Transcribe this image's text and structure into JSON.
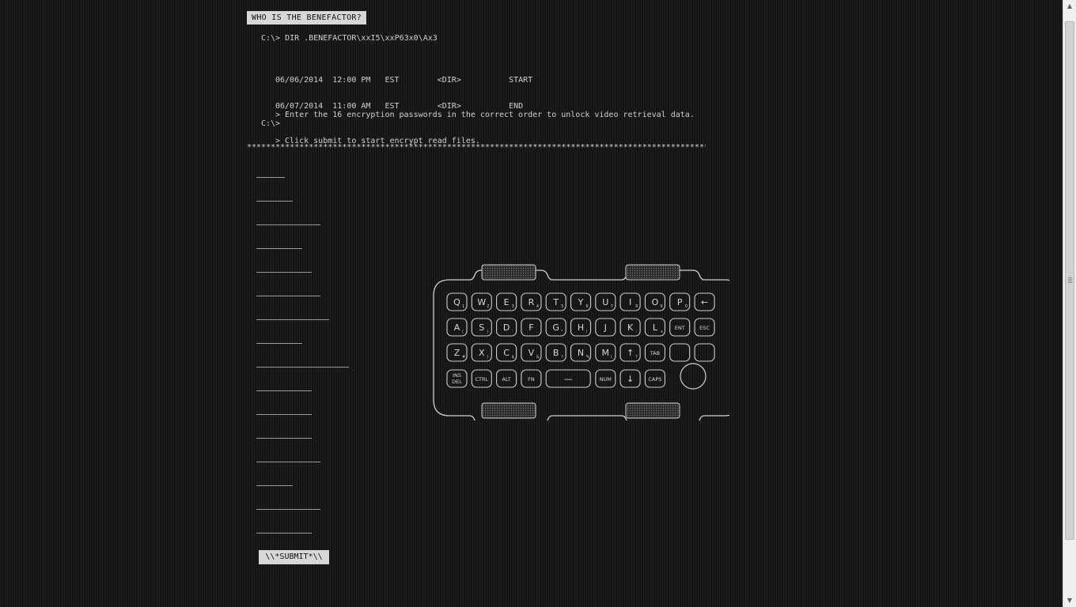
{
  "header": {
    "title": "WHO IS THE BENEFACTOR?"
  },
  "terminal": {
    "command": "C:\\> DIR .BENEFACTOR\\xxI5\\xxP63x0\\Ax3",
    "listing": [
      {
        "date": "06/06/2014",
        "time": "12:00 PM",
        "zone": "EST",
        "type": "<DIR>",
        "name": "START"
      },
      {
        "date": "06/07/2014",
        "time": "11:00 AM",
        "zone": "EST",
        "type": "<DIR>",
        "name": "END"
      }
    ],
    "instructions": [
      "> Enter the 16 encryption passwords in the correct order to unlock video retrieval data.",
      "> Click submit to start encrypt read files."
    ],
    "prompt": "C:\\>"
  },
  "separator": "*************************************************************************************************",
  "passwords": {
    "count": 16,
    "values": [
      "",
      "",
      "",
      "",
      "",
      "",
      "",
      "",
      "",
      "",
      "",
      "",
      "",
      "",
      "",
      ""
    ]
  },
  "submit": {
    "label": "\\\\*SUBMIT*\\\\"
  },
  "keyboard": {
    "rows": [
      [
        {
          "k": "Q",
          "s": "1"
        },
        {
          "k": "W",
          "s": "2"
        },
        {
          "k": "E",
          "s": "3"
        },
        {
          "k": "R",
          "s": "4"
        },
        {
          "k": "T",
          "s": "5"
        },
        {
          "k": "Y",
          "s": "6"
        },
        {
          "k": "U",
          "s": "7"
        },
        {
          "k": "I",
          "s": "8"
        },
        {
          "k": "O",
          "s": "9"
        },
        {
          "k": "P",
          "s": "0"
        },
        {
          "k": "←",
          "s": ""
        }
      ],
      [
        {
          "k": "A",
          "s": "("
        },
        {
          "k": "S",
          "s": ")"
        },
        {
          "k": "D",
          "s": "'"
        },
        {
          "k": "F",
          "s": "."
        },
        {
          "k": "G",
          "s": "\""
        },
        {
          "k": "H",
          "s": "/"
        },
        {
          "k": "J",
          "s": "."
        },
        {
          "k": "K",
          "s": ":"
        },
        {
          "k": "L",
          "s": "+"
        },
        {
          "k": "ENT",
          "s": ""
        },
        {
          "k": "ESC",
          "s": ""
        }
      ],
      [
        {
          "k": "Z",
          "s": "#"
        },
        {
          "k": "X",
          "s": ")"
        },
        {
          "k": "C",
          "s": "$"
        },
        {
          "k": "V",
          "s": "&"
        },
        {
          "k": "B",
          "s": "?"
        },
        {
          "k": "N",
          "s": "%"
        },
        {
          "k": "M",
          "s": "\\"
        },
        {
          "k": "↑",
          "s": "?"
        },
        {
          "k": "TAB",
          "s": ""
        },
        {
          "k": "",
          "s": ""
        },
        {
          "k": "",
          "s": ""
        }
      ],
      [
        {
          "k": "INS DEL",
          "s": ""
        },
        {
          "k": "CTRL",
          "s": ""
        },
        {
          "k": "ALT",
          "s": ""
        },
        {
          "k": "FN",
          "s": ""
        },
        {
          "k": "—",
          "s": ""
        },
        {
          "k": "NUM",
          "s": ""
        },
        {
          "k": "↓",
          "s": ""
        },
        {
          "k": "CAPS",
          "s": ""
        }
      ]
    ]
  },
  "colors": {
    "background": "#141414",
    "text": "#d0d0d0",
    "badge": "#d7d7d7"
  }
}
